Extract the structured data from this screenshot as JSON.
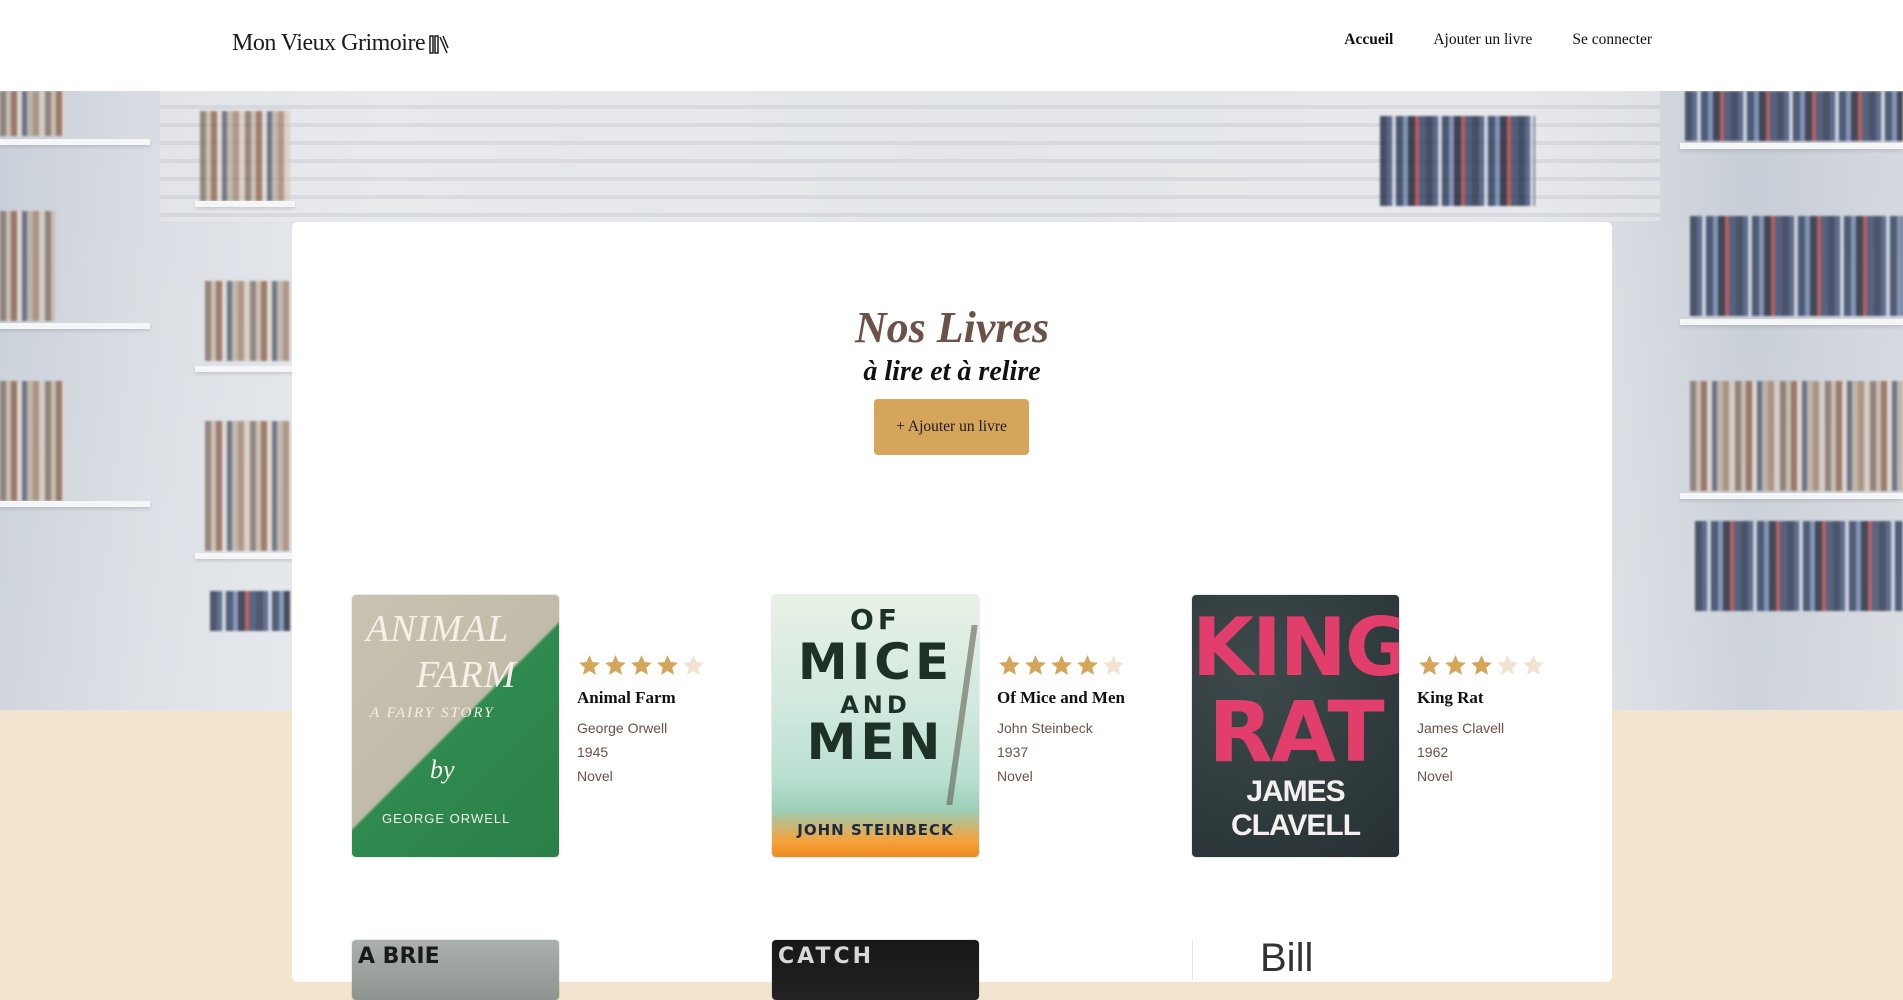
{
  "header": {
    "logo_text": "Mon Vieux Grimoire",
    "logo_icon": "books-icon",
    "nav": [
      {
        "label": "Accueil",
        "active": true
      },
      {
        "label": "Ajouter un livre",
        "active": false
      },
      {
        "label": "Se connecter",
        "active": false
      }
    ]
  },
  "main": {
    "title": "Nos Livres",
    "subtitle": "à lire et à relire",
    "add_button_label": "+ Ajouter un livre"
  },
  "books": [
    {
      "title": "Animal Farm",
      "author": "George Orwell",
      "year": "1945",
      "genre": "Novel",
      "rating": 4,
      "cover": {
        "line1": "ANIMAL",
        "line2": "FARM",
        "line3": "A FAIRY STORY",
        "line4": "by",
        "line5": "GEORGE ORWELL"
      }
    },
    {
      "title": "Of Mice and Men",
      "author": "John Steinbeck",
      "year": "1937",
      "genre": "Novel",
      "rating": 4,
      "cover": {
        "line1": "OF",
        "line2": "MICE",
        "line3": "AND",
        "line4": "MEN",
        "line5": "JOHN STEINBECK"
      }
    },
    {
      "title": "King Rat",
      "author": "James Clavell",
      "year": "1962",
      "genre": "Novel",
      "rating": 3,
      "cover": {
        "line1": "KING",
        "line2": "RAT",
        "line3": "JAMES CLAVELL"
      }
    }
  ],
  "partial_row": {
    "cover1_text": "A BRIE",
    "cover2_text": "CATCH",
    "item3_text": "Bill"
  },
  "colors": {
    "accent": "#d6a55c",
    "title_brown": "#6b5148",
    "star_filled": "#d6a55c",
    "star_empty": "#f1e3cf",
    "page_bg": "#f3e4d0"
  }
}
